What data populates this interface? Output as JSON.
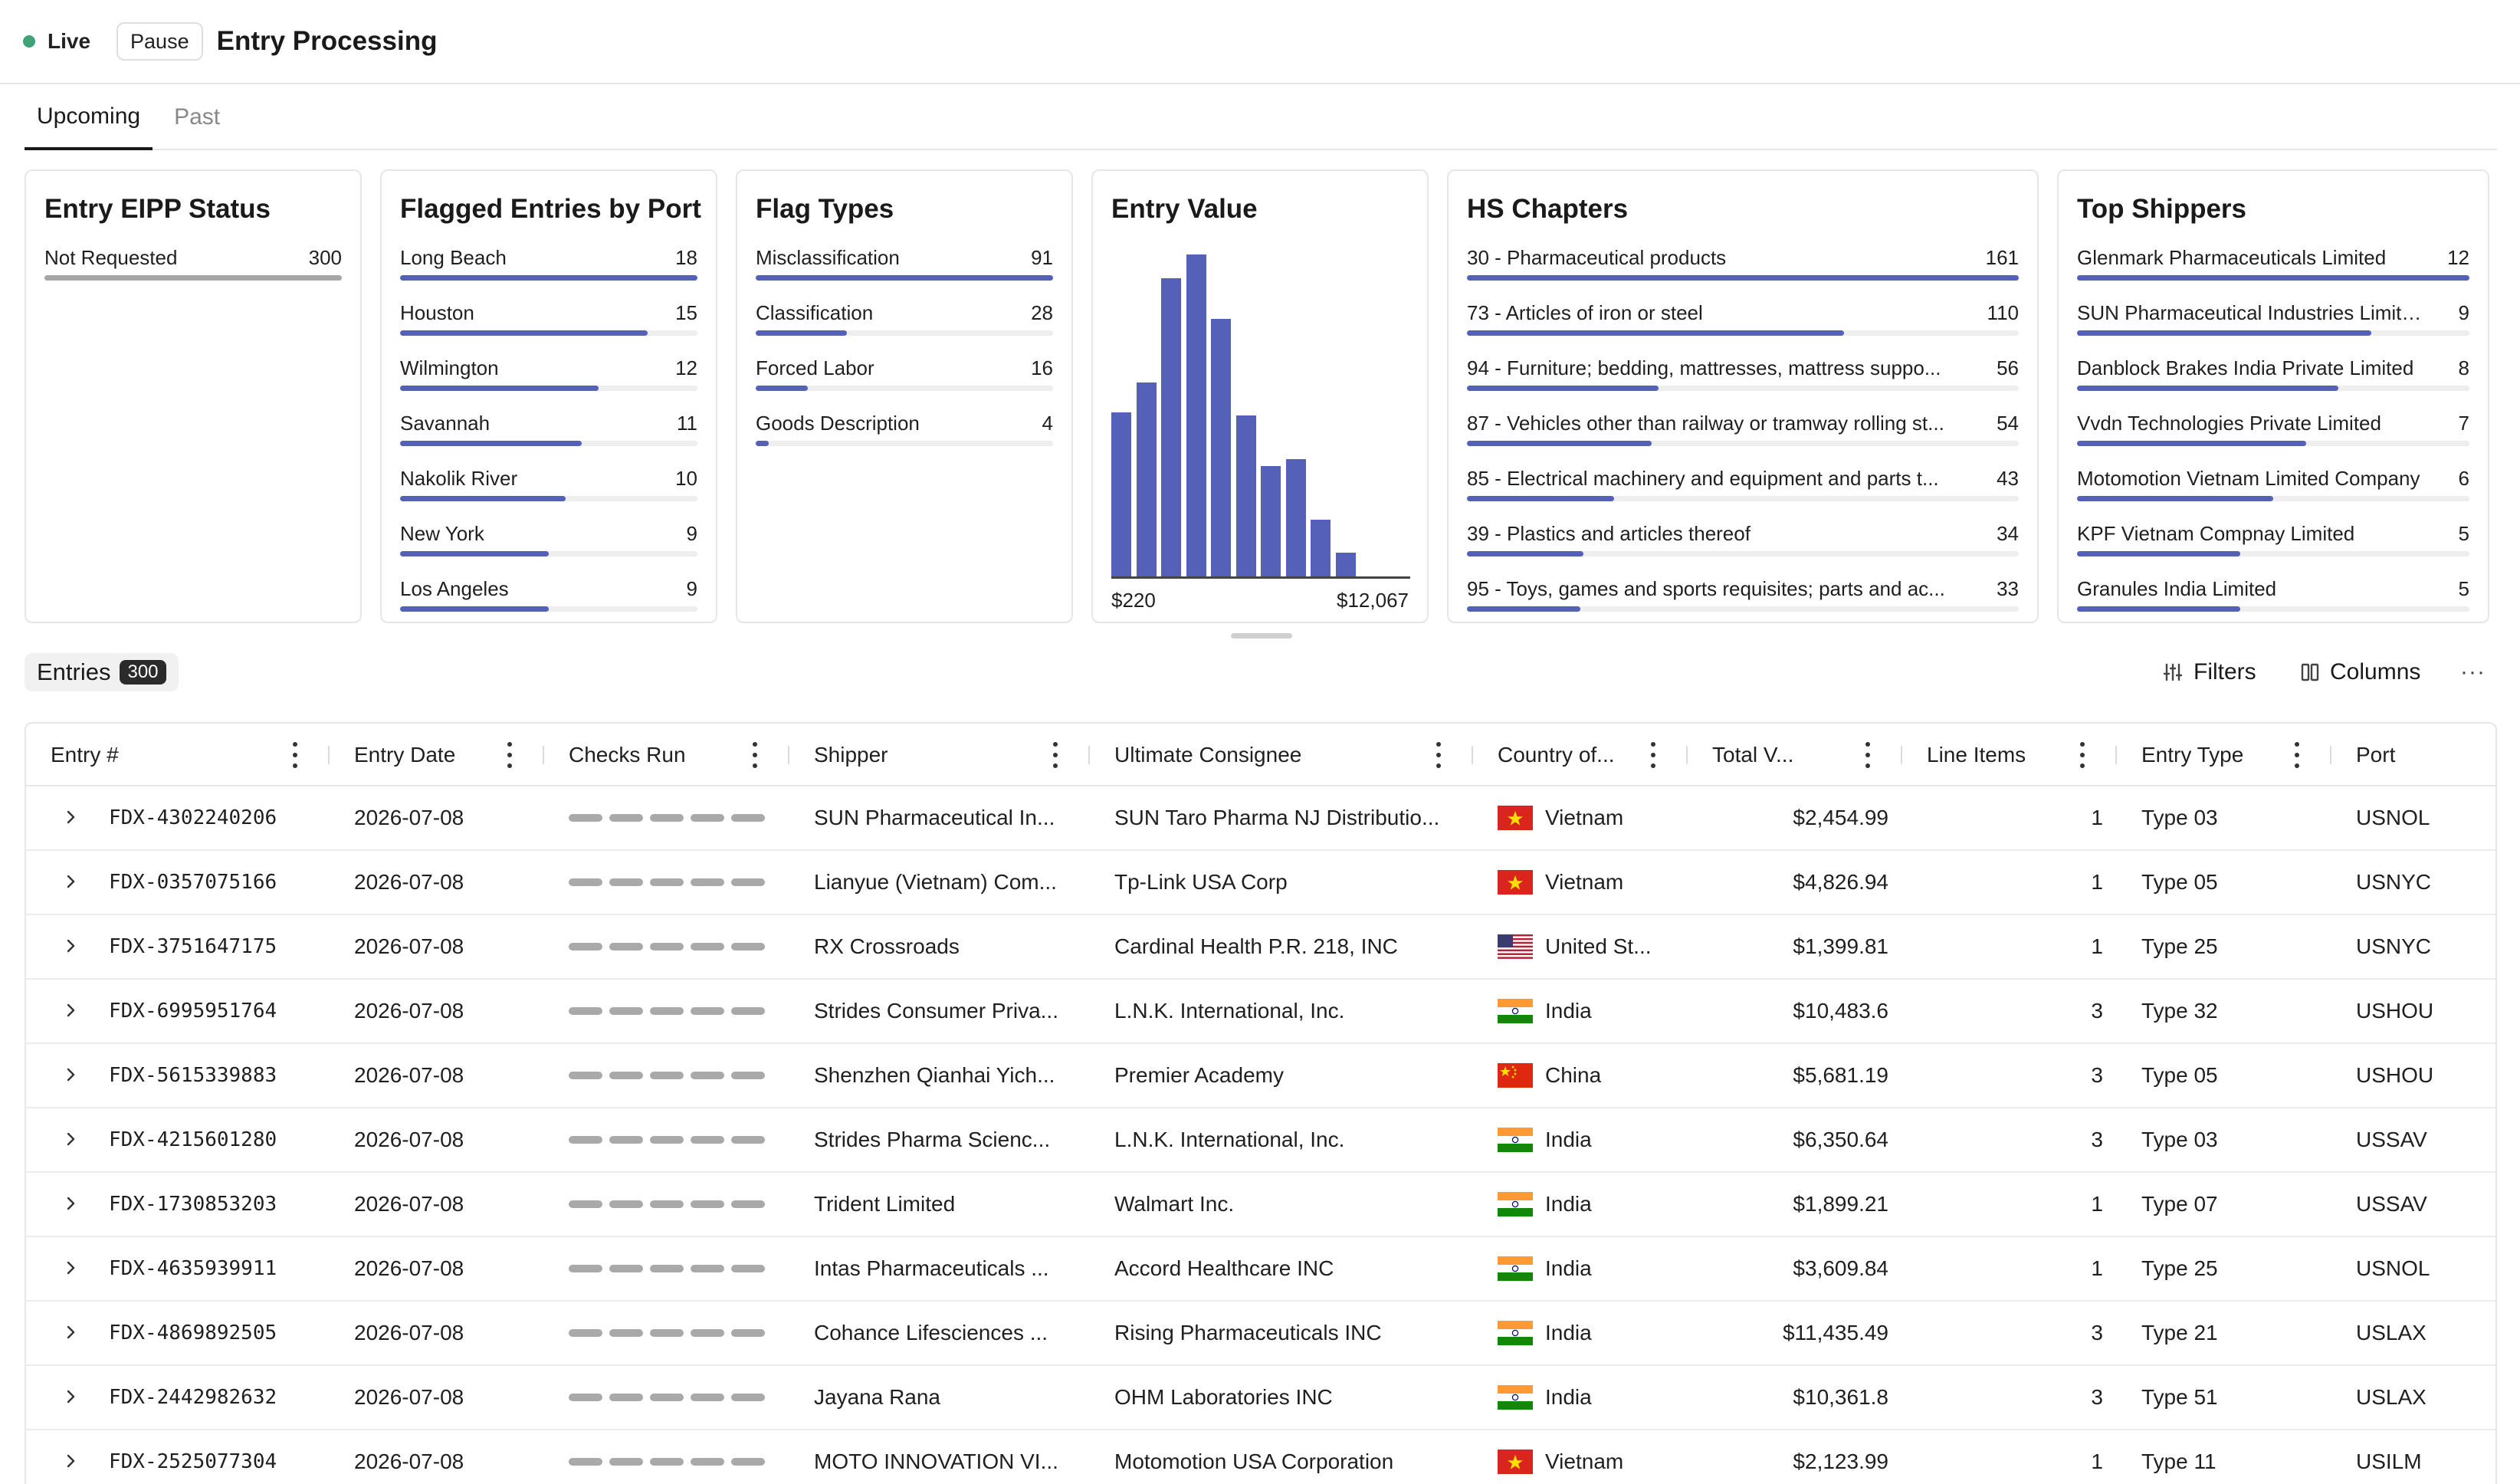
{
  "header": {
    "live_label": "Live",
    "pause_label": "Pause",
    "title": "Entry Processing"
  },
  "tabs": [
    {
      "label": "Upcoming",
      "active": true
    },
    {
      "label": "Past",
      "active": false
    }
  ],
  "colors": {
    "accent": "#5560b8",
    "live": "#3fa37a",
    "neutral_bar": "#a6a6a6"
  },
  "cards": {
    "eipp": {
      "title": "Entry EIPP Status",
      "max": 300,
      "items": [
        {
          "label": "Not Requested",
          "value": 300
        }
      ]
    },
    "ports": {
      "title": "Flagged Entries by Port",
      "max": 18,
      "items": [
        {
          "label": "Long Beach",
          "value": 18
        },
        {
          "label": "Houston",
          "value": 15
        },
        {
          "label": "Wilmington",
          "value": 12
        },
        {
          "label": "Savannah",
          "value": 11
        },
        {
          "label": "Nakolik River",
          "value": 10
        },
        {
          "label": "New York",
          "value": 9
        },
        {
          "label": "Los Angeles",
          "value": 9
        }
      ]
    },
    "flags": {
      "title": "Flag Types",
      "max": 91,
      "items": [
        {
          "label": "Misclassification",
          "value": 91
        },
        {
          "label": "Classification",
          "value": 28
        },
        {
          "label": "Forced Labor",
          "value": 16
        },
        {
          "label": "Goods Description",
          "value": 4
        }
      ]
    },
    "value": {
      "title": "Entry Value",
      "min_label": "$220",
      "max_label": "$12,067"
    },
    "hs": {
      "title": "HS Chapters",
      "max": 161,
      "items": [
        {
          "label": "30 - Pharmaceutical products",
          "value": 161
        },
        {
          "label": "73 - Articles of iron or steel",
          "value": 110
        },
        {
          "label": "94 - Furniture; bedding, mattresses, mattress suppo...",
          "value": 56
        },
        {
          "label": "87 - Vehicles other than railway or tramway rolling st...",
          "value": 54
        },
        {
          "label": "85 - Electrical machinery and equipment and parts t...",
          "value": 43
        },
        {
          "label": "39 - Plastics and articles thereof",
          "value": 34
        },
        {
          "label": "95 - Toys, games and sports requisites; parts and ac...",
          "value": 33
        }
      ]
    },
    "shippers": {
      "title": "Top Shippers",
      "max": 12,
      "items": [
        {
          "label": "Glenmark Pharmaceuticals Limited",
          "value": 12
        },
        {
          "label": "SUN Pharmaceutical Industries Limited",
          "value": 9
        },
        {
          "label": "Danblock Brakes India Private Limited",
          "value": 8
        },
        {
          "label": "Vvdn Technologies Private Limited",
          "value": 7
        },
        {
          "label": "Motomotion Vietnam Limited Company",
          "value": 6
        },
        {
          "label": "KPF Vietnam Compnay Limited",
          "value": 5
        },
        {
          "label": "Granules India Limited",
          "value": 5
        }
      ]
    }
  },
  "chart_data": {
    "type": "bar",
    "title": "Entry Value",
    "categories": [
      "b1",
      "b2",
      "b3",
      "b4",
      "b5",
      "b6",
      "b7",
      "b8",
      "b9",
      "b10",
      "b11",
      "b12"
    ],
    "values": [
      49,
      58,
      89,
      96,
      77,
      48,
      33,
      35,
      17,
      7,
      0,
      0
    ],
    "xlim_labels": [
      "$220",
      "$12,067"
    ],
    "ylim": [
      0,
      100
    ],
    "grid": false
  },
  "entries": {
    "label": "Entries",
    "count": "300",
    "filters_label": "Filters",
    "columns_label": "Columns",
    "more_label": "···",
    "columns": [
      "Entry #",
      "Entry Date",
      "Checks Run",
      "Shipper",
      "Ultimate Consignee",
      "Country of...",
      "Total V...",
      "Line Items",
      "Entry Type",
      "Port"
    ],
    "rows": [
      {
        "id": "FDX-4302240206",
        "date": "2026-07-08",
        "shipper": "SUN Pharmaceutical In...",
        "consignee": "SUN Taro Pharma NJ Distributio...",
        "flag": "vietnam",
        "country": "Vietnam",
        "total": "$2,454.99",
        "lines": "1",
        "type": "Type 03",
        "port": "USNOL"
      },
      {
        "id": "FDX-0357075166",
        "date": "2026-07-08",
        "shipper": "Lianyue (Vietnam) Com...",
        "consignee": "Tp-Link USA Corp",
        "flag": "vietnam",
        "country": "Vietnam",
        "total": "$4,826.94",
        "lines": "1",
        "type": "Type 05",
        "port": "USNYC"
      },
      {
        "id": "FDX-3751647175",
        "date": "2026-07-08",
        "shipper": "RX Crossroads",
        "consignee": "Cardinal Health P.R. 218, INC",
        "flag": "usa",
        "country": "United St...",
        "total": "$1,399.81",
        "lines": "1",
        "type": "Type 25",
        "port": "USNYC"
      },
      {
        "id": "FDX-6995951764",
        "date": "2026-07-08",
        "shipper": "Strides Consumer Priva...",
        "consignee": "L.N.K. International, Inc.",
        "flag": "india",
        "country": "India",
        "total": "$10,483.6",
        "lines": "3",
        "type": "Type 32",
        "port": "USHOU"
      },
      {
        "id": "FDX-5615339883",
        "date": "2026-07-08",
        "shipper": "Shenzhen Qianhai Yich...",
        "consignee": "Premier Academy",
        "flag": "china",
        "country": "China",
        "total": "$5,681.19",
        "lines": "3",
        "type": "Type 05",
        "port": "USHOU"
      },
      {
        "id": "FDX-4215601280",
        "date": "2026-07-08",
        "shipper": "Strides Pharma Scienc...",
        "consignee": "L.N.K. International, Inc.",
        "flag": "india",
        "country": "India",
        "total": "$6,350.64",
        "lines": "3",
        "type": "Type 03",
        "port": "USSAV"
      },
      {
        "id": "FDX-1730853203",
        "date": "2026-07-08",
        "shipper": "Trident Limited",
        "consignee": "Walmart Inc.",
        "flag": "india",
        "country": "India",
        "total": "$1,899.21",
        "lines": "1",
        "type": "Type 07",
        "port": "USSAV"
      },
      {
        "id": "FDX-4635939911",
        "date": "2026-07-08",
        "shipper": "Intas Pharmaceuticals ...",
        "consignee": "Accord Healthcare INC",
        "flag": "india",
        "country": "India",
        "total": "$3,609.84",
        "lines": "1",
        "type": "Type 25",
        "port": "USNOL"
      },
      {
        "id": "FDX-4869892505",
        "date": "2026-07-08",
        "shipper": "Cohance Lifesciences ...",
        "consignee": "Rising Pharmaceuticals INC",
        "flag": "india",
        "country": "India",
        "total": "$11,435.49",
        "lines": "3",
        "type": "Type 21",
        "port": "USLAX"
      },
      {
        "id": "FDX-2442982632",
        "date": "2026-07-08",
        "shipper": "Jayana Rana",
        "consignee": "OHM Laboratories INC",
        "flag": "india",
        "country": "India",
        "total": "$10,361.8",
        "lines": "3",
        "type": "Type 51",
        "port": "USLAX"
      },
      {
        "id": "FDX-2525077304",
        "date": "2026-07-08",
        "shipper": "MOTO INNOVATION VI...",
        "consignee": "Motomotion USA Corporation",
        "flag": "vietnam",
        "country": "Vietnam",
        "total": "$2,123.99",
        "lines": "1",
        "type": "Type 11",
        "port": "USILM"
      }
    ]
  }
}
